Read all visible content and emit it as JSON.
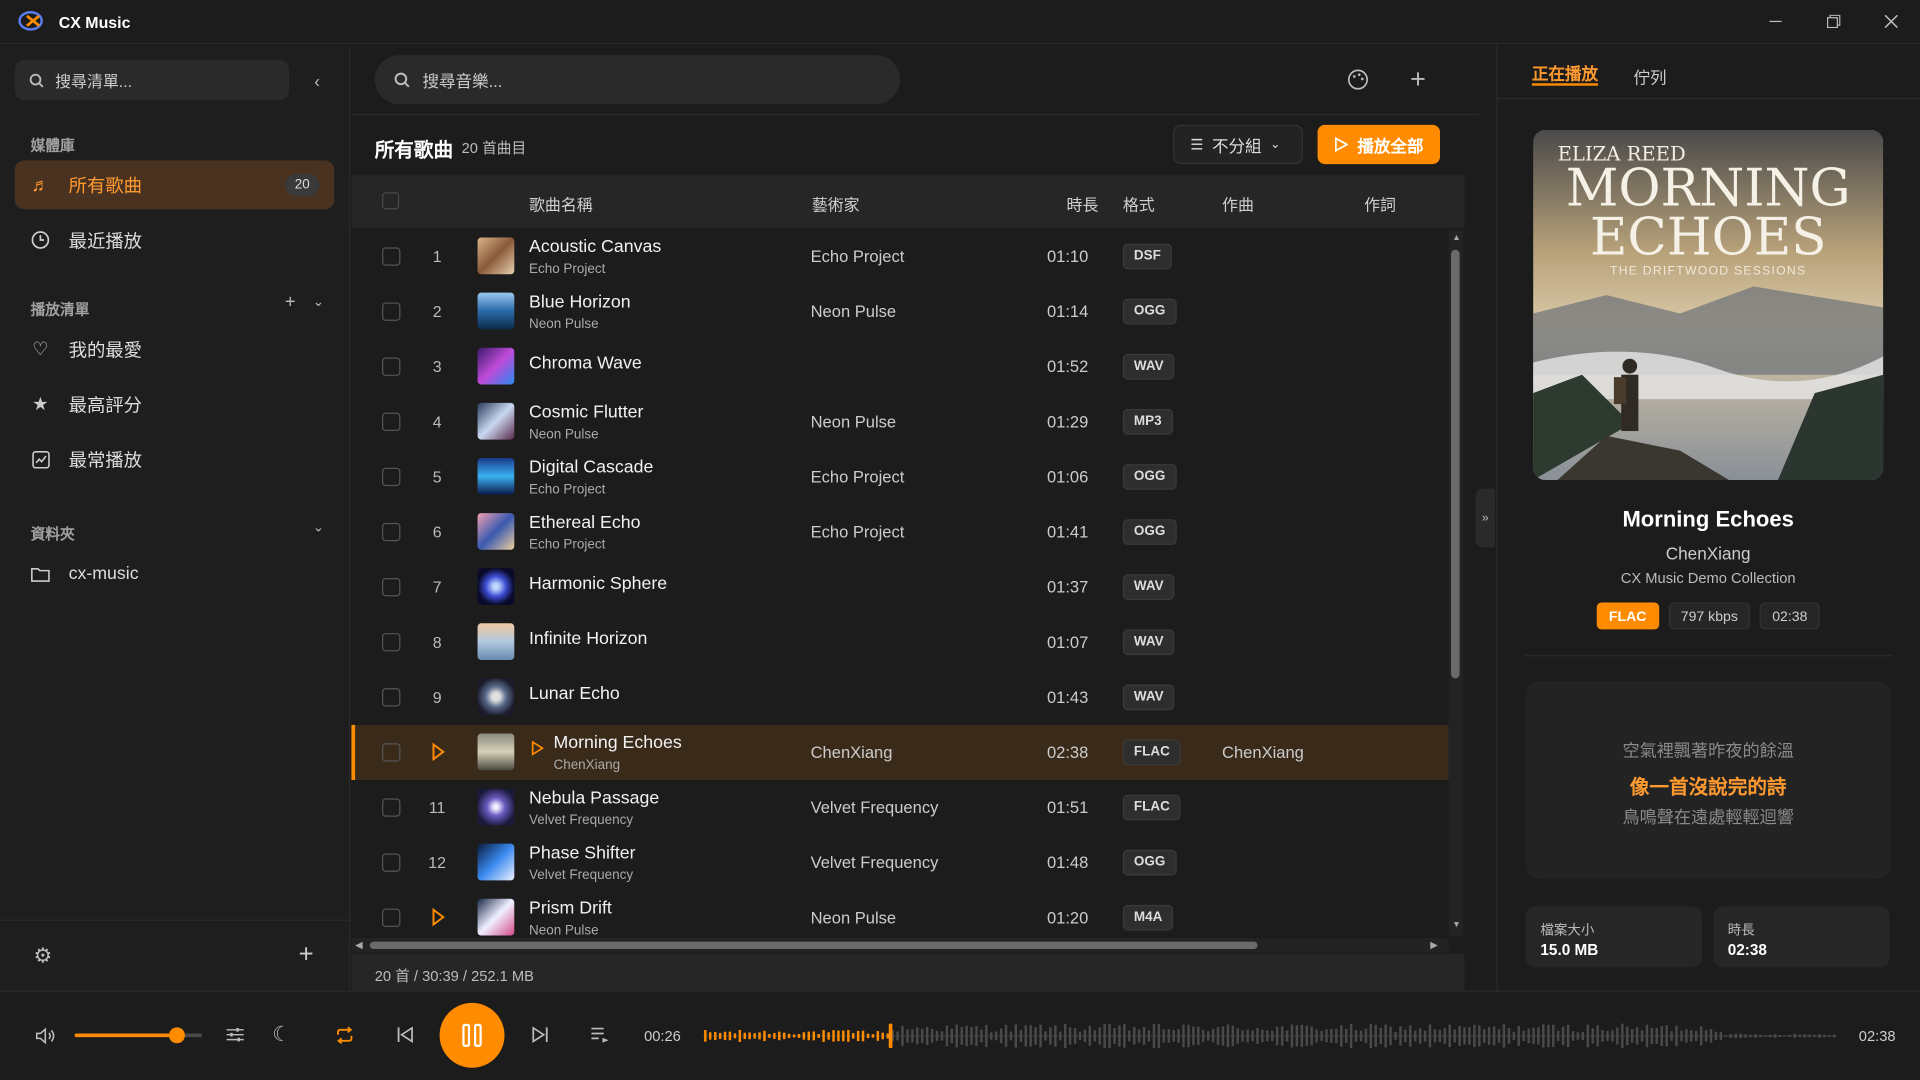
{
  "app": {
    "title": "CX Music"
  },
  "window": {
    "minimize_icon": "minimize-icon",
    "restore_icon": "restore-icon",
    "close_icon": "close-icon"
  },
  "sidebar": {
    "search_placeholder": "搜尋清單...",
    "library_label": "媒體庫",
    "library_items": [
      {
        "label": "所有歌曲",
        "badge": "20",
        "icon": "music-note-icon",
        "active": true
      },
      {
        "label": "最近播放",
        "icon": "clock-icon"
      }
    ],
    "playlists_label": "播放清單",
    "playlist_items": [
      {
        "label": "我的最愛",
        "icon": "heart-icon"
      },
      {
        "label": "最高評分",
        "icon": "star-icon"
      },
      {
        "label": "最常播放",
        "icon": "chart-icon"
      }
    ],
    "folders_label": "資料夾",
    "folder_items": [
      {
        "label": "cx-music",
        "icon": "folder-icon"
      }
    ]
  },
  "main": {
    "search_placeholder": "搜尋音樂...",
    "heading": "所有歌曲",
    "count": "20 首曲目",
    "group_label": "不分組",
    "play_all_label": "播放全部",
    "columns": {
      "title": "歌曲名稱",
      "artist": "藝術家",
      "duration": "時長",
      "format": "格式",
      "composer": "作曲",
      "lyricist": "作詞"
    },
    "tracks": [
      {
        "num": "1",
        "title": "Acoustic Canvas",
        "sub": "Echo Project",
        "artist": "Echo Project",
        "dur": "01:10",
        "fmt": "DSF",
        "composer": ""
      },
      {
        "num": "2",
        "title": "Blue Horizon",
        "sub": "Neon Pulse",
        "artist": "Neon Pulse",
        "dur": "01:14",
        "fmt": "OGG",
        "composer": ""
      },
      {
        "num": "3",
        "title": "Chroma Wave",
        "sub": "",
        "artist": "",
        "dur": "01:52",
        "fmt": "WAV",
        "composer": ""
      },
      {
        "num": "4",
        "title": "Cosmic Flutter",
        "sub": "Neon Pulse",
        "artist": "Neon Pulse",
        "dur": "01:29",
        "fmt": "MP3",
        "composer": ""
      },
      {
        "num": "5",
        "title": "Digital Cascade",
        "sub": "Echo Project",
        "artist": "Echo Project",
        "dur": "01:06",
        "fmt": "OGG",
        "composer": ""
      },
      {
        "num": "6",
        "title": "Ethereal Echo",
        "sub": "Echo Project",
        "artist": "Echo Project",
        "dur": "01:41",
        "fmt": "OGG",
        "composer": ""
      },
      {
        "num": "7",
        "title": "Harmonic Sphere",
        "sub": "",
        "artist": "",
        "dur": "01:37",
        "fmt": "WAV",
        "composer": ""
      },
      {
        "num": "8",
        "title": "Infinite Horizon",
        "sub": "",
        "artist": "",
        "dur": "01:07",
        "fmt": "WAV",
        "composer": ""
      },
      {
        "num": "9",
        "title": "Lunar Echo",
        "sub": "",
        "artist": "",
        "dur": "01:43",
        "fmt": "WAV",
        "composer": ""
      },
      {
        "num": "",
        "title": "Morning Echoes",
        "sub": "ChenXiang",
        "artist": "ChenXiang",
        "dur": "02:38",
        "fmt": "FLAC",
        "composer": "ChenXiang",
        "playing": true
      },
      {
        "num": "11",
        "title": "Nebula Passage",
        "sub": "Velvet Frequency",
        "artist": "Velvet Frequency",
        "dur": "01:51",
        "fmt": "FLAC",
        "composer": ""
      },
      {
        "num": "12",
        "title": "Phase Shifter",
        "sub": "Velvet Frequency",
        "artist": "Velvet Frequency",
        "dur": "01:48",
        "fmt": "OGG",
        "composer": ""
      },
      {
        "num": "",
        "title": "Prism Drift",
        "sub": "Neon Pulse",
        "artist": "Neon Pulse",
        "dur": "01:20",
        "fmt": "M4A",
        "composer": "",
        "hover": true
      }
    ],
    "footer_stats": "20 首 / 30:39 / 252.1 MB"
  },
  "now_playing": {
    "tab_now": "正在播放",
    "tab_queue": "佇列",
    "art": {
      "artist": "ELIZA REED",
      "title_line1": "MORNING",
      "title_line2": "ECHOES",
      "subtitle": "THE DRIFTWOOD SESSIONS"
    },
    "title": "Morning Echoes",
    "artist": "ChenXiang",
    "album": "CX Music Demo Collection",
    "format": "FLAC",
    "bitrate": "797 kbps",
    "duration": "02:38",
    "lyrics": [
      "空氣裡飄著昨夜的餘溫",
      "像一首沒說完的詩",
      "鳥鳴聲在遠處輕輕迴響"
    ],
    "file_size_label": "檔案大小",
    "file_size": "15.0 MB",
    "duration_label": "時長",
    "duration_value": "02:38"
  },
  "player": {
    "volume": 0.8,
    "elapsed": "00:26",
    "total": "02:38",
    "progress": 0.165,
    "accent": "#ff8c00"
  }
}
